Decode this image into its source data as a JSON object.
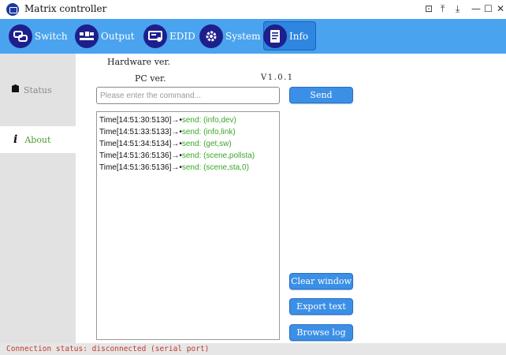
{
  "app": {
    "title": "Matrix controller"
  },
  "window_controls": [
    "⊡",
    "⤒",
    "⤓",
    "—",
    "☐",
    "✕"
  ],
  "toolbar": {
    "buttons": [
      {
        "label": "Switch",
        "icon": "switch-icon"
      },
      {
        "label": "Output",
        "icon": "output-icon"
      },
      {
        "label": "EDID",
        "icon": "edid-icon"
      },
      {
        "label": "System",
        "icon": "system-gear-icon"
      },
      {
        "label": "Info",
        "icon": "info-document-icon",
        "active": true
      }
    ]
  },
  "sidebar": {
    "items": [
      {
        "label": "Status",
        "icon": "status-icon",
        "active": false
      },
      {
        "label": "About",
        "icon": "about-i-icon",
        "active": true
      }
    ]
  },
  "about": {
    "hardware_label": "Hardware ver.",
    "pc_label": "PC ver.",
    "pc_value": "V1.0.1"
  },
  "command": {
    "placeholder": "Please enter the command...",
    "value": "",
    "send_label": "Send"
  },
  "log": [
    {
      "prefix": "Time[14:51:30:5130]→•",
      "command": "send: (info,dev)"
    },
    {
      "prefix": "Time[14:51:33:5133]→•",
      "command": "send: (info,link)"
    },
    {
      "prefix": "Time[14:51:34:5134]→•",
      "command": "send: (get,sw)"
    },
    {
      "prefix": "Time[14:51:36:5136]→•",
      "command": "send: (scene,pollsta)"
    },
    {
      "prefix": "Time[14:51:36:5136]→•",
      "command": "send: (scene,sta,0)"
    }
  ],
  "actions": {
    "clear_label": "Clear window",
    "export_label": "Export text",
    "browse_label": "Browse log"
  },
  "status": {
    "text": "Connection status: disconnected (serial port)"
  },
  "colors": {
    "toolbar": "#4aa3ee",
    "button": "#3b8fe6",
    "command_text": "#3aa62a",
    "status_text": "#c0392b"
  }
}
